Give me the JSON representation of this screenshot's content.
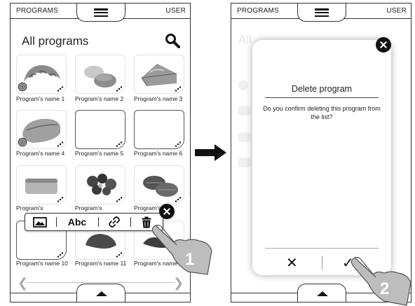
{
  "left_screen": {
    "tab_programs": "PROGRAMS",
    "tab_user": "USER",
    "title": "All programs",
    "programs": [
      {
        "label": "Program's name 1"
      },
      {
        "label": "Program's name 2"
      },
      {
        "label": "Program's name 3"
      },
      {
        "label": "Program's name 4"
      },
      {
        "label": "Program's name 5"
      },
      {
        "label": "Program's name 6"
      },
      {
        "label": "Program's"
      },
      {
        "label": "Program's"
      },
      {
        "label": "Program's"
      },
      {
        "label": "Program's name 10"
      },
      {
        "label": "Program's name 11"
      },
      {
        "label": "Program's name 12"
      }
    ],
    "toolbar": {
      "text_label": "Abc"
    }
  },
  "right_screen": {
    "tab_programs": "PROGRAMS",
    "tab_user": "USER",
    "ghost_title": "All",
    "dialog": {
      "title": "Delete program",
      "message": "Do you confirm deleting this program from the list?",
      "cancel": "✕",
      "confirm": "✓"
    }
  },
  "steps": [
    "1",
    "2"
  ],
  "icons": [
    "hamburger-icon",
    "search-icon",
    "image-icon",
    "link-icon",
    "trash-icon",
    "close-icon",
    "chevron-left-icon",
    "chevron-right-icon",
    "triangle-up-icon",
    "arrow-right-icon",
    "pointing-hand-icon"
  ]
}
